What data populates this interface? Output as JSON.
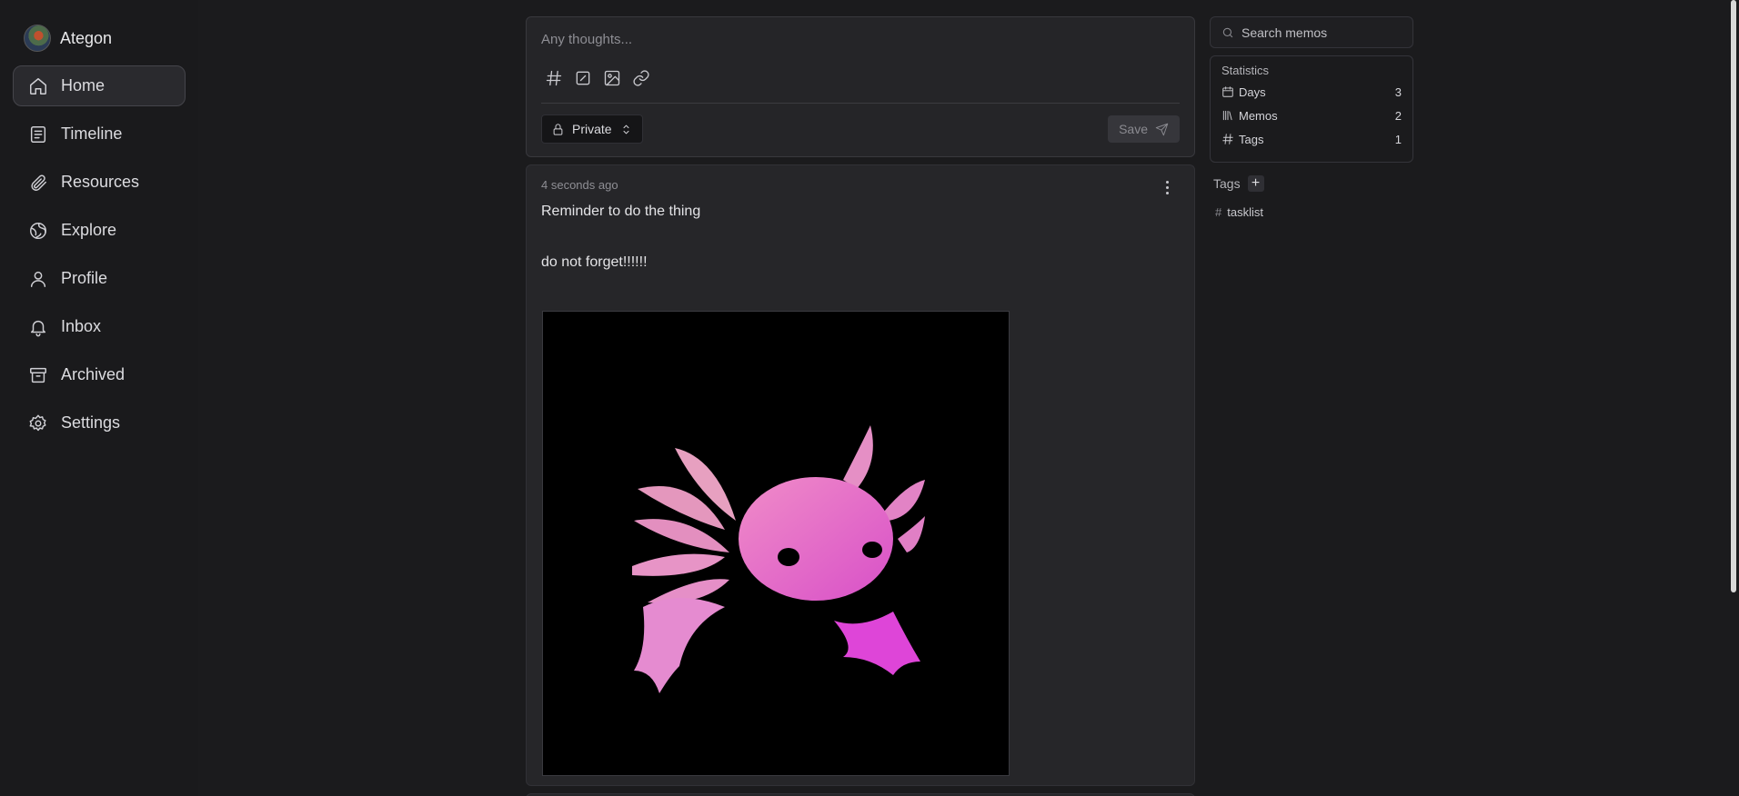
{
  "user": {
    "name": "Ategon"
  },
  "nav": [
    {
      "label": "Home",
      "icon": "home-icon",
      "active": true
    },
    {
      "label": "Timeline",
      "icon": "timeline-icon"
    },
    {
      "label": "Resources",
      "icon": "paperclip-icon"
    },
    {
      "label": "Explore",
      "icon": "globe-icon"
    },
    {
      "label": "Profile",
      "icon": "user-icon"
    },
    {
      "label": "Inbox",
      "icon": "bell-icon"
    },
    {
      "label": "Archived",
      "icon": "archive-icon"
    },
    {
      "label": "Settings",
      "icon": "gear-icon"
    }
  ],
  "editor": {
    "placeholder": "Any thoughts...",
    "visibility": "Private",
    "save_label": "Save"
  },
  "memo": {
    "time": "4 seconds ago",
    "line1": "Reminder to do the thing",
    "line2": "do not forget!!!!!!"
  },
  "search": {
    "placeholder": "Search memos"
  },
  "statistics": {
    "title": "Statistics",
    "rows": [
      {
        "label": "Days",
        "value": "3",
        "icon": "calendar-icon"
      },
      {
        "label": "Memos",
        "value": "2",
        "icon": "library-icon"
      },
      {
        "label": "Tags",
        "value": "1",
        "icon": "hash-icon"
      }
    ]
  },
  "tags": {
    "title": "Tags",
    "items": [
      {
        "label": "tasklist"
      }
    ]
  },
  "colors": {
    "background": "#1b1b1d",
    "card": "#262629",
    "axolotl": "#e870c8"
  }
}
